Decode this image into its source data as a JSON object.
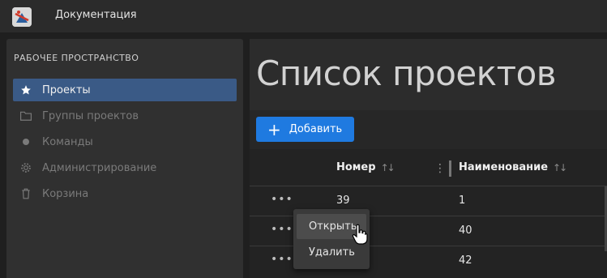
{
  "app": {
    "title": "Документация",
    "logo_icon": "app-logo-icon"
  },
  "sidebar": {
    "heading": "РАБОЧЕЕ ПРОСТРАНСТВО",
    "items": [
      {
        "label": "Проекты",
        "icon": "star-icon",
        "active": true
      },
      {
        "label": "Группы проектов",
        "icon": "folder-icon",
        "active": false
      },
      {
        "label": "Команды",
        "icon": "dot-icon",
        "active": false
      },
      {
        "label": "Администрирование",
        "icon": "gear-icon",
        "active": false
      },
      {
        "label": "Корзина",
        "icon": "trash-icon",
        "active": false
      }
    ]
  },
  "main": {
    "title": "Список проектов",
    "add_button": {
      "label": "Добавить",
      "icon": "plus-icon"
    },
    "table": {
      "columns": [
        {
          "label": "Номер",
          "sort_icon": "sort-icon"
        },
        {
          "label": "Наименование",
          "sort_icon": "sort-icon"
        }
      ],
      "rows": [
        {
          "number": "39",
          "name": "1"
        },
        {
          "number": "",
          "name": "40"
        },
        {
          "number": "",
          "name": "42"
        }
      ]
    }
  },
  "context_menu": {
    "items": [
      {
        "label": "Открыть",
        "hovered": true
      },
      {
        "label": "Удалить",
        "hovered": false
      }
    ]
  },
  "colors": {
    "accent": "#1f7ae0",
    "active_nav": "#3a5a86",
    "background": "#1f1f1f"
  }
}
